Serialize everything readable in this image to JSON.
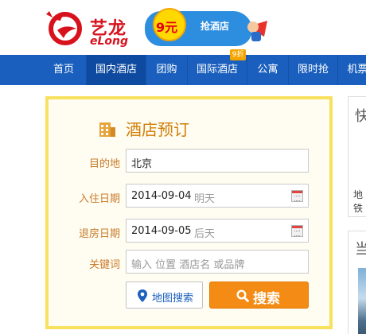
{
  "brand": {
    "name_cn": "艺龙",
    "name_en": "eLong",
    "logo_color": "#d8121d"
  },
  "promo": {
    "price": "9元",
    "text": "抢酒店"
  },
  "nav": {
    "items": [
      {
        "label": "首页",
        "active": false
      },
      {
        "label": "国内酒店",
        "active": true
      },
      {
        "label": "团购",
        "active": false
      },
      {
        "label": "国际酒店",
        "active": false
      },
      {
        "label": "公寓",
        "active": false
      },
      {
        "label": "限时抢",
        "active": false
      },
      {
        "label": "机票",
        "active": false
      }
    ],
    "badge": "9折",
    "bg_color": "#1a5fbd"
  },
  "booking": {
    "title": "酒店预订",
    "destination": {
      "label": "目的地",
      "value": "北京"
    },
    "checkin": {
      "label": "入住日期",
      "value": "2014-09-04",
      "day": "明天"
    },
    "checkout": {
      "label": "退房日期",
      "value": "2014-09-05",
      "day": "后天"
    },
    "keyword": {
      "label": "关键词",
      "placeholder": "输入 位置 酒店名 或品牌"
    },
    "map_search_label": "地图搜索",
    "search_label": "搜索",
    "accent_color": "#f38b14",
    "border_color": "#f9e160"
  },
  "side": {
    "box1_title": "快",
    "box1_text": "地铁",
    "box2_title": "当"
  }
}
